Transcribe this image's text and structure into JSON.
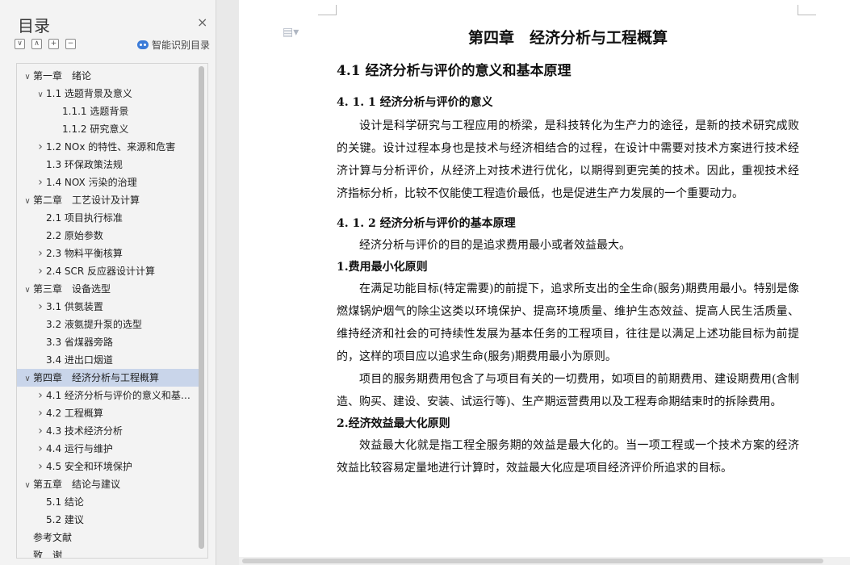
{
  "sidebar": {
    "title": "目录",
    "close_label": "×",
    "tools": [
      "∨",
      "∧",
      "+",
      "−"
    ],
    "smart_label": "智能识别目录",
    "toc": [
      {
        "label": "第一章　绪论",
        "level": 0,
        "arrow": "open",
        "selected": false
      },
      {
        "label": "1.1  选题背景及意义",
        "level": 1,
        "arrow": "open",
        "selected": false
      },
      {
        "label": "1.1.1  选题背景",
        "level": 2,
        "arrow": "none",
        "selected": false
      },
      {
        "label": "1.1.2  研究意义",
        "level": 2,
        "arrow": "none",
        "selected": false
      },
      {
        "label": "1.2 NOx 的特性、来源和危害",
        "level": 1,
        "arrow": "closed",
        "selected": false
      },
      {
        "label": "1.3  环保政策法规",
        "level": 1,
        "arrow": "none",
        "selected": false
      },
      {
        "label": "1.4 NOX 污染的治理",
        "level": 1,
        "arrow": "closed",
        "selected": false
      },
      {
        "label": "第二章　工艺设计及计算",
        "level": 0,
        "arrow": "open",
        "selected": false
      },
      {
        "label": "2.1  项目执行标准",
        "level": 1,
        "arrow": "none",
        "selected": false
      },
      {
        "label": "2.2  原始参数",
        "level": 1,
        "arrow": "none",
        "selected": false
      },
      {
        "label": "2.3 物料平衡核算",
        "level": 1,
        "arrow": "closed",
        "selected": false
      },
      {
        "label": "2.4 SCR 反应器设计计算",
        "level": 1,
        "arrow": "closed",
        "selected": false
      },
      {
        "label": "第三章　设备选型",
        "level": 0,
        "arrow": "open",
        "selected": false
      },
      {
        "label": "3.1  供氨装置",
        "level": 1,
        "arrow": "closed",
        "selected": false
      },
      {
        "label": "3.2  液氨提升泵的选型",
        "level": 1,
        "arrow": "none",
        "selected": false
      },
      {
        "label": "3.3  省煤器旁路",
        "level": 1,
        "arrow": "none",
        "selected": false
      },
      {
        "label": "3.4  进出口烟道",
        "level": 1,
        "arrow": "none",
        "selected": false
      },
      {
        "label": "第四章　经济分析与工程概算",
        "level": 0,
        "arrow": "open",
        "selected": true
      },
      {
        "label": "4.1  经济分析与评价的意义和基本原理",
        "level": 1,
        "arrow": "closed",
        "selected": false
      },
      {
        "label": "4.2  工程概算",
        "level": 1,
        "arrow": "closed",
        "selected": false
      },
      {
        "label": "4.3  技术经济分析",
        "level": 1,
        "arrow": "closed",
        "selected": false
      },
      {
        "label": "4.4  运行与维护",
        "level": 1,
        "arrow": "closed",
        "selected": false
      },
      {
        "label": "4.5 安全和环境保护",
        "level": 1,
        "arrow": "closed",
        "selected": false
      },
      {
        "label": "第五章　结论与建议",
        "level": 0,
        "arrow": "open",
        "selected": false
      },
      {
        "label": "5.1  结论",
        "level": 1,
        "arrow": "none",
        "selected": false
      },
      {
        "label": "5.2  建议",
        "level": 1,
        "arrow": "none",
        "selected": false
      },
      {
        "label": "参考文献",
        "level": 0,
        "arrow": "none",
        "selected": false
      },
      {
        "label": "致　谢",
        "level": 0,
        "arrow": "none",
        "selected": false
      }
    ]
  },
  "document": {
    "chapter_title": "第四章　经济分析与工程概算",
    "section_title": "4.1  经济分析与评价的意义和基本原理",
    "sub1_title": "4. 1. 1  经济分析与评价的意义",
    "sub1_p1": "设计是科学研究与工程应用的桥梁，是科技转化为生产力的途径，是新的技术研究成败的关键。设计过程本身也是技术与经济相结合的过程，在设计中需要对技术方案进行技术经济计算与分析评价，从经济上对技术进行优化，以期得到更完美的技术。因此，重视技术经济指标分析，比较不仅能使工程造价最低，也是促进生产力发展的一个重要动力。",
    "sub2_title": "4. 1. 2  经济分析与评价的基本原理",
    "sub2_p1": "经济分析与评价的目的是追求费用最小或者效益最大。",
    "principle1_title": "1.费用最小化原则",
    "principle1_p1": "在满足功能目标(特定需要)的前提下，追求所支出的全生命(服务)期费用最小。特别是像燃煤锅炉烟气的除尘这类以环境保护、提高环境质量、维护生态效益、提高人民生活质量、维持经济和社会的可持续性发展为基本任务的工程项目，往往是以满足上述功能目标为前提的，这样的项目应以追求生命(服务)期费用最小为原则。",
    "principle1_p2": "项目的服务期费用包含了与项目有关的一切费用，如项目的前期费用、建设期费用(含制造、购买、建设、安装、试运行等)、生产期运营费用以及工程寿命期结束时的拆除费用。",
    "principle2_title": "2.经济效益最大化原则",
    "principle2_p1": "效益最大化就是指工程全服务期的效益是最大化的。当一项工程或一个技术方案的经济效益比较容易定量地进行计算时，效益最大化应是项目经济评价所追求的目标。"
  }
}
